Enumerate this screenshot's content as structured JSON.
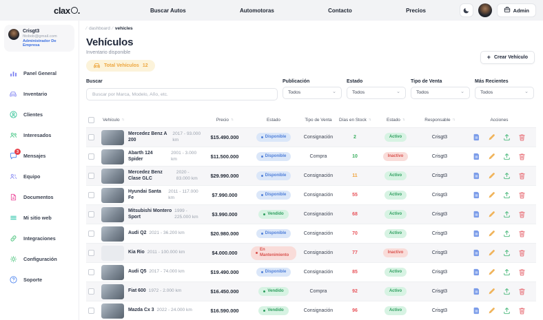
{
  "topbar": {
    "logo_text": "clax",
    "logo_dot": ".",
    "links": [
      "Buscar Autos",
      "Automotoras",
      "Contacto",
      "Precios"
    ],
    "admin_button": "Admin"
  },
  "sidebar": {
    "user": {
      "name": "Crisgt3",
      "email": "fitobob@gmail.com",
      "role": "Administrador De Empresa"
    },
    "items": [
      {
        "label": "Panel General",
        "icon": "bar-chart",
        "color": "#7b80f2"
      },
      {
        "label": "Inventario",
        "icon": "car",
        "color": "#8d90f4"
      },
      {
        "label": "Clientes",
        "icon": "user-circle",
        "color": "#45c8a0"
      },
      {
        "label": "Interesados",
        "icon": "user-search",
        "color": "#4fc98c"
      },
      {
        "label": "Mensajes",
        "icon": "chat",
        "color": "#5b8ef0",
        "badge": "3"
      },
      {
        "label": "Equipo",
        "icon": "users",
        "color": "#8d90f4"
      },
      {
        "label": "Documentos",
        "icon": "document",
        "color": "#ee5fa7"
      },
      {
        "label": "Mi sitio web",
        "icon": "menu-lines",
        "color": "#3ec9b0"
      },
      {
        "label": "Integraciones",
        "icon": "link",
        "color": "#57c785"
      },
      {
        "label": "Configuración",
        "icon": "gear",
        "color": "#57c785"
      },
      {
        "label": "Soporte",
        "icon": "help-circle",
        "color": "#5b8ef0"
      }
    ]
  },
  "page": {
    "breadcrumb": [
      "dashboard",
      "vehicles"
    ],
    "title": "Vehículos",
    "subtitle": "Inventario disponible",
    "total_badge": {
      "label": "Total Vehículos",
      "count": "12"
    },
    "create_button": "Crear Vehículo"
  },
  "filters": {
    "search_label": "Buscar",
    "search_placeholder": "Buscar por Marca, Modelo, Año, etc.",
    "selects": [
      {
        "label": "Publicación",
        "value": "Todos"
      },
      {
        "label": "Estado",
        "value": "Todos"
      },
      {
        "label": "Tipo de Venta",
        "value": "Todos"
      },
      {
        "label": "Más Recientes",
        "value": "Todos"
      }
    ]
  },
  "table": {
    "columns": [
      {
        "label": "Vehículo",
        "sortable": true
      },
      {
        "label": "Precio",
        "sortable": true
      },
      {
        "label": "Estado",
        "sortable": false
      },
      {
        "label": "Tipo de Venta",
        "sortable": false
      },
      {
        "label": "Días en Stock",
        "sortable": true
      },
      {
        "label": "Estado",
        "sortable": true
      },
      {
        "label": "Responsable",
        "sortable": true
      },
      {
        "label": "Acciones",
        "sortable": false
      }
    ],
    "actions": [
      {
        "name": "view",
        "icon": "file"
      },
      {
        "name": "edit",
        "icon": "pencil"
      },
      {
        "name": "publish",
        "icon": "upload"
      },
      {
        "name": "delete",
        "icon": "trash"
      }
    ],
    "rows": [
      {
        "name": "Mercedez Benz A 200",
        "spec": "2017 - 93.000 km",
        "price": "$15.490.000",
        "status": "Disponible",
        "status_type": "available",
        "sale_type": "Consignación",
        "days": "2",
        "days_level": "green",
        "state": "Activo",
        "state_type": "active",
        "responsible": "Crisgt3",
        "has_image": true
      },
      {
        "name": "Abarth 124 Spider",
        "spec": "2001 - 3.000 km",
        "price": "$11.500.000",
        "status": "Disponible",
        "status_type": "available",
        "sale_type": "Compra",
        "days": "10",
        "days_level": "green",
        "state": "Inactivo",
        "state_type": "inactive",
        "responsible": "Crisgt3",
        "has_image": true
      },
      {
        "name": "Mercedez Benz Clase GLC",
        "spec": "2020 - 83.000 km",
        "price": "$29.990.000",
        "status": "Disponible",
        "status_type": "available",
        "sale_type": "Consignación",
        "days": "11",
        "days_level": "orange",
        "state": "Activo",
        "state_type": "active",
        "responsible": "Crisgt3",
        "has_image": true
      },
      {
        "name": "Hyundai Santa Fe",
        "spec": "2011 - 117.000 km",
        "price": "$7.990.000",
        "status": "Disponible",
        "status_type": "available",
        "sale_type": "Consignación",
        "days": "55",
        "days_level": "red",
        "state": "Activo",
        "state_type": "active",
        "responsible": "Crisgt3",
        "has_image": true
      },
      {
        "name": "Mitsubishi Montero Sport",
        "spec": "1999 - 225.000 km",
        "price": "$3.990.000",
        "status": "Vendido",
        "status_type": "sold",
        "sale_type": "Consignación",
        "days": "68",
        "days_level": "red",
        "state": "Activo",
        "state_type": "active",
        "responsible": "Crisgt3",
        "has_image": true
      },
      {
        "name": "Audi Q2",
        "spec": "2021 - 36.200 km",
        "price": "$20.980.000",
        "status": "Disponible",
        "status_type": "available",
        "sale_type": "Consignación",
        "days": "70",
        "days_level": "red",
        "state": "Activo",
        "state_type": "active",
        "responsible": "Crisgt3",
        "has_image": true
      },
      {
        "name": "Kia Rio",
        "spec": "2011 - 100.000 km",
        "price": "$4.000.000",
        "status": "En Mantenimiento",
        "status_type": "maintenance",
        "sale_type": "Consignación",
        "days": "77",
        "days_level": "red",
        "state": "Inactivo",
        "state_type": "inactive",
        "responsible": "Crisgt3",
        "has_image": false
      },
      {
        "name": "Audi Q5",
        "spec": "2017 - 74.000 km",
        "price": "$19.490.000",
        "status": "Disponible",
        "status_type": "available",
        "sale_type": "Consignación",
        "days": "85",
        "days_level": "red",
        "state": "Activo",
        "state_type": "active",
        "responsible": "Crisgt3",
        "has_image": true
      },
      {
        "name": "Fiat 600",
        "spec": "1972 - 2.000 km",
        "price": "$16.450.000",
        "status": "Vendido",
        "status_type": "sold",
        "sale_type": "Compra",
        "days": "92",
        "days_level": "red",
        "state": "Activo",
        "state_type": "active",
        "responsible": "Crisgt3",
        "has_image": true
      },
      {
        "name": "Mazda Cx 3",
        "spec": "2022 - 24.000 km",
        "price": "$16.590.000",
        "status": "Vendido",
        "status_type": "sold",
        "sale_type": "Consignación",
        "days": "96",
        "days_level": "red",
        "state": "Activo",
        "state_type": "active",
        "responsible": "Crisgt3",
        "has_image": true
      }
    ]
  },
  "colors": {
    "available_pill": "#4f7fd9",
    "sold_pill": "#2f9e5f",
    "maintenance_pill": "#d9534f",
    "active_pill": "#2f9e5f",
    "inactive_pill": "#d9534f",
    "stock_green": "#3aaf5f",
    "stock_orange": "#f0a33c",
    "stock_red": "#e8535a",
    "badge_bg": "#fcf3da",
    "badge_text": "#eda63f",
    "role_text": "#3b6fe0",
    "message_badge": "#e8404a"
  }
}
